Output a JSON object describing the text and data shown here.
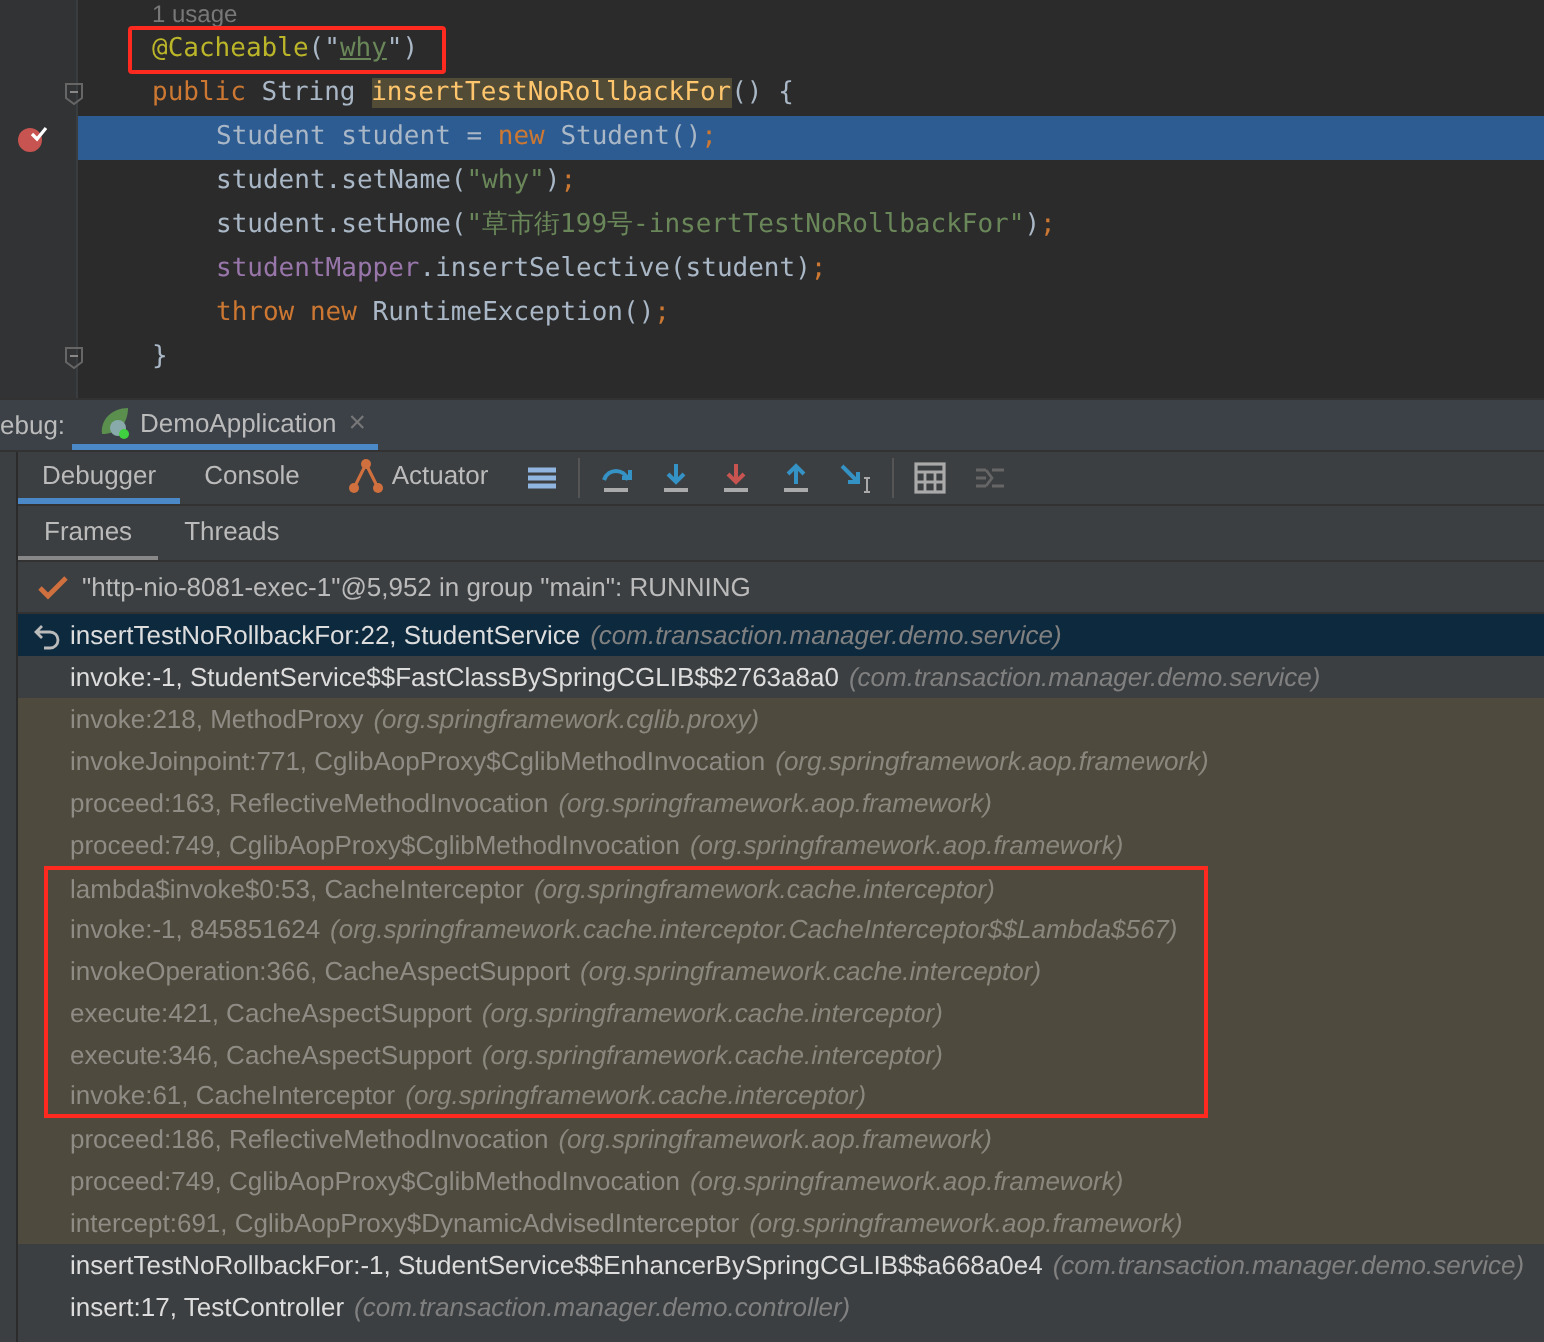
{
  "editor": {
    "usage_hint": "1 usage",
    "lines": [
      {
        "boxed": true,
        "current": false,
        "breakpoint": false,
        "fold": false,
        "tokens": [
          {
            "kind": "annotation",
            "text": "@Cacheable"
          },
          {
            "kind": "plain",
            "text": "(\""
          },
          {
            "kind": "string-link",
            "text": "why"
          },
          {
            "kind": "plain",
            "text": "\")"
          }
        ]
      },
      {
        "boxed": false,
        "current": false,
        "breakpoint": false,
        "fold": true,
        "tokens": [
          {
            "kind": "keyword",
            "text": "public "
          },
          {
            "kind": "plain",
            "text": "String "
          },
          {
            "kind": "method-decl",
            "text": "insertTestNoRollbackFor"
          },
          {
            "kind": "plain",
            "text": "() {"
          }
        ],
        "children": [
          {
            "boxed": false,
            "current": true,
            "breakpoint": true,
            "fold": false,
            "tokens": [
              {
                "kind": "plain",
                "text": "Student student = "
              },
              {
                "kind": "keyword",
                "text": "new "
              },
              {
                "kind": "plain",
                "text": "Student()"
              },
              {
                "kind": "keyword",
                "text": ";"
              }
            ]
          },
          {
            "boxed": false,
            "current": false,
            "breakpoint": false,
            "fold": false,
            "tokens": [
              {
                "kind": "plain",
                "text": "student.setName("
              },
              {
                "kind": "string",
                "text": "\"why\""
              },
              {
                "kind": "plain",
                "text": ")"
              },
              {
                "kind": "keyword",
                "text": ";"
              }
            ]
          },
          {
            "boxed": false,
            "current": false,
            "breakpoint": false,
            "fold": false,
            "tokens": [
              {
                "kind": "plain",
                "text": "student.setHome("
              },
              {
                "kind": "string",
                "text": "\"草市街199号-insertTestNoRollbackFor\""
              },
              {
                "kind": "plain",
                "text": ")"
              },
              {
                "kind": "keyword",
                "text": ";"
              }
            ]
          },
          {
            "boxed": false,
            "current": false,
            "breakpoint": false,
            "fold": false,
            "tokens": [
              {
                "kind": "field",
                "text": "studentMapper"
              },
              {
                "kind": "plain",
                "text": ".insertSelective(student)"
              },
              {
                "kind": "keyword",
                "text": ";"
              }
            ]
          },
          {
            "boxed": false,
            "current": false,
            "breakpoint": false,
            "fold": false,
            "tokens": [
              {
                "kind": "keyword",
                "text": "throw new "
              },
              {
                "kind": "plain",
                "text": "RuntimeException()"
              },
              {
                "kind": "keyword",
                "text": ";"
              }
            ]
          }
        ]
      },
      {
        "boxed": false,
        "current": false,
        "breakpoint": false,
        "fold": true,
        "tokens": [
          {
            "kind": "plain",
            "text": "}"
          }
        ]
      }
    ]
  },
  "debug": {
    "label": "ebug:",
    "session_tab": {
      "title": "DemoApplication",
      "close": "×"
    },
    "tabs": [
      {
        "label": "Debugger",
        "selected": true
      },
      {
        "label": "Console",
        "selected": false
      },
      {
        "label": "Actuator",
        "selected": false
      }
    ],
    "subtabs": [
      {
        "label": "Frames",
        "selected": true
      },
      {
        "label": "Threads",
        "selected": false
      }
    ],
    "thread": "\"http-nio-8081-exec-1\"@5,952 in group \"main\": RUNNING",
    "frames": [
      {
        "name": "insertTestNoRollbackFor:22, StudentService",
        "package": "(com.transaction.manager.demo.service)",
        "selected": true,
        "library": false,
        "boxed": false
      },
      {
        "name": "invoke:-1, StudentService$$FastClassBySpringCGLIB$$2763a8a0",
        "package": "(com.transaction.manager.demo.service)",
        "selected": false,
        "library": false,
        "boxed": false
      },
      {
        "name": "invoke:218, MethodProxy",
        "package": "(org.springframework.cglib.proxy)",
        "selected": false,
        "library": true,
        "boxed": false
      },
      {
        "name": "invokeJoinpoint:771, CglibAopProxy$CglibMethodInvocation",
        "package": "(org.springframework.aop.framework)",
        "selected": false,
        "library": true,
        "boxed": false
      },
      {
        "name": "proceed:163, ReflectiveMethodInvocation",
        "package": "(org.springframework.aop.framework)",
        "selected": false,
        "library": true,
        "boxed": false
      },
      {
        "name": "proceed:749, CglibAopProxy$CglibMethodInvocation",
        "package": "(org.springframework.aop.framework)",
        "selected": false,
        "library": true,
        "boxed": false
      },
      {
        "name": "lambda$invoke$0:53, CacheInterceptor",
        "package": "(org.springframework.cache.interceptor)",
        "selected": false,
        "library": true,
        "boxed": true
      },
      {
        "name": "invoke:-1, 845851624",
        "package": "(org.springframework.cache.interceptor.CacheInterceptor$$Lambda$567)",
        "selected": false,
        "library": true,
        "boxed": true
      },
      {
        "name": "invokeOperation:366, CacheAspectSupport",
        "package": "(org.springframework.cache.interceptor)",
        "selected": false,
        "library": true,
        "boxed": true
      },
      {
        "name": "execute:421, CacheAspectSupport",
        "package": "(org.springframework.cache.interceptor)",
        "selected": false,
        "library": true,
        "boxed": true
      },
      {
        "name": "execute:346, CacheAspectSupport",
        "package": "(org.springframework.cache.interceptor)",
        "selected": false,
        "library": true,
        "boxed": true
      },
      {
        "name": "invoke:61, CacheInterceptor",
        "package": "(org.springframework.cache.interceptor)",
        "selected": false,
        "library": true,
        "boxed": true
      },
      {
        "name": "proceed:186, ReflectiveMethodInvocation",
        "package": "(org.springframework.aop.framework)",
        "selected": false,
        "library": true,
        "boxed": false
      },
      {
        "name": "proceed:749, CglibAopProxy$CglibMethodInvocation",
        "package": "(org.springframework.aop.framework)",
        "selected": false,
        "library": true,
        "boxed": false
      },
      {
        "name": "intercept:691, CglibAopProxy$DynamicAdvisedInterceptor",
        "package": "(org.springframework.aop.framework)",
        "selected": false,
        "library": true,
        "boxed": false
      },
      {
        "name": "insertTestNoRollbackFor:-1, StudentService$$EnhancerBySpringCGLIB$$a668a0e4",
        "package": "(com.transaction.manager.demo.service)",
        "selected": false,
        "library": false,
        "boxed": false
      },
      {
        "name": "insert:17, TestController",
        "package": "(com.transaction.manager.demo.controller)",
        "selected": false,
        "library": false,
        "boxed": false
      }
    ]
  }
}
